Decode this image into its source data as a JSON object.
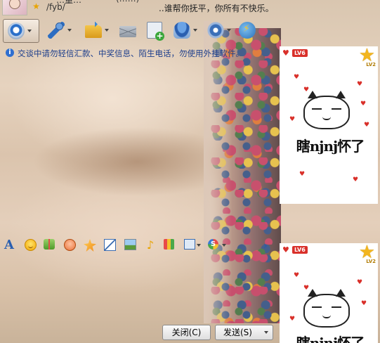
{
  "header": {
    "nickname": "…量…",
    "account": "(……)",
    "path": "/fyb/",
    "signature": "..谁帮你抚平，你所有不快乐。"
  },
  "toolbar": {
    "items": [
      {
        "name": "video-call",
        "icon": "webcam-icon"
      },
      {
        "name": "voice-call",
        "icon": "microphone-icon"
      },
      {
        "name": "send-file",
        "icon": "folder-icon"
      },
      {
        "name": "mail",
        "icon": "envelope-icon"
      },
      {
        "name": "add-contact",
        "icon": "add-document-icon"
      },
      {
        "name": "remote",
        "icon": "user-badge-icon"
      },
      {
        "name": "settings",
        "icon": "gear-icon"
      },
      {
        "name": "apps",
        "icon": "app-icon"
      }
    ]
  },
  "notice": {
    "text": "交谈中请勿轻信汇款、中奖信息、陌生电话，勿使用外挂软件。"
  },
  "show_panels": [
    {
      "level": "LV6",
      "star_level": "LV2",
      "caption": "瞎njnj怀了"
    },
    {
      "level": "LV6",
      "star_level": "LV2",
      "caption": "瞎njnj怀了"
    }
  ],
  "buttons": {
    "close": "关闭(C)",
    "send": "发送(S)"
  },
  "colors": {
    "notice_text": "#1e3f8c",
    "level_badge": "#d9302a"
  }
}
